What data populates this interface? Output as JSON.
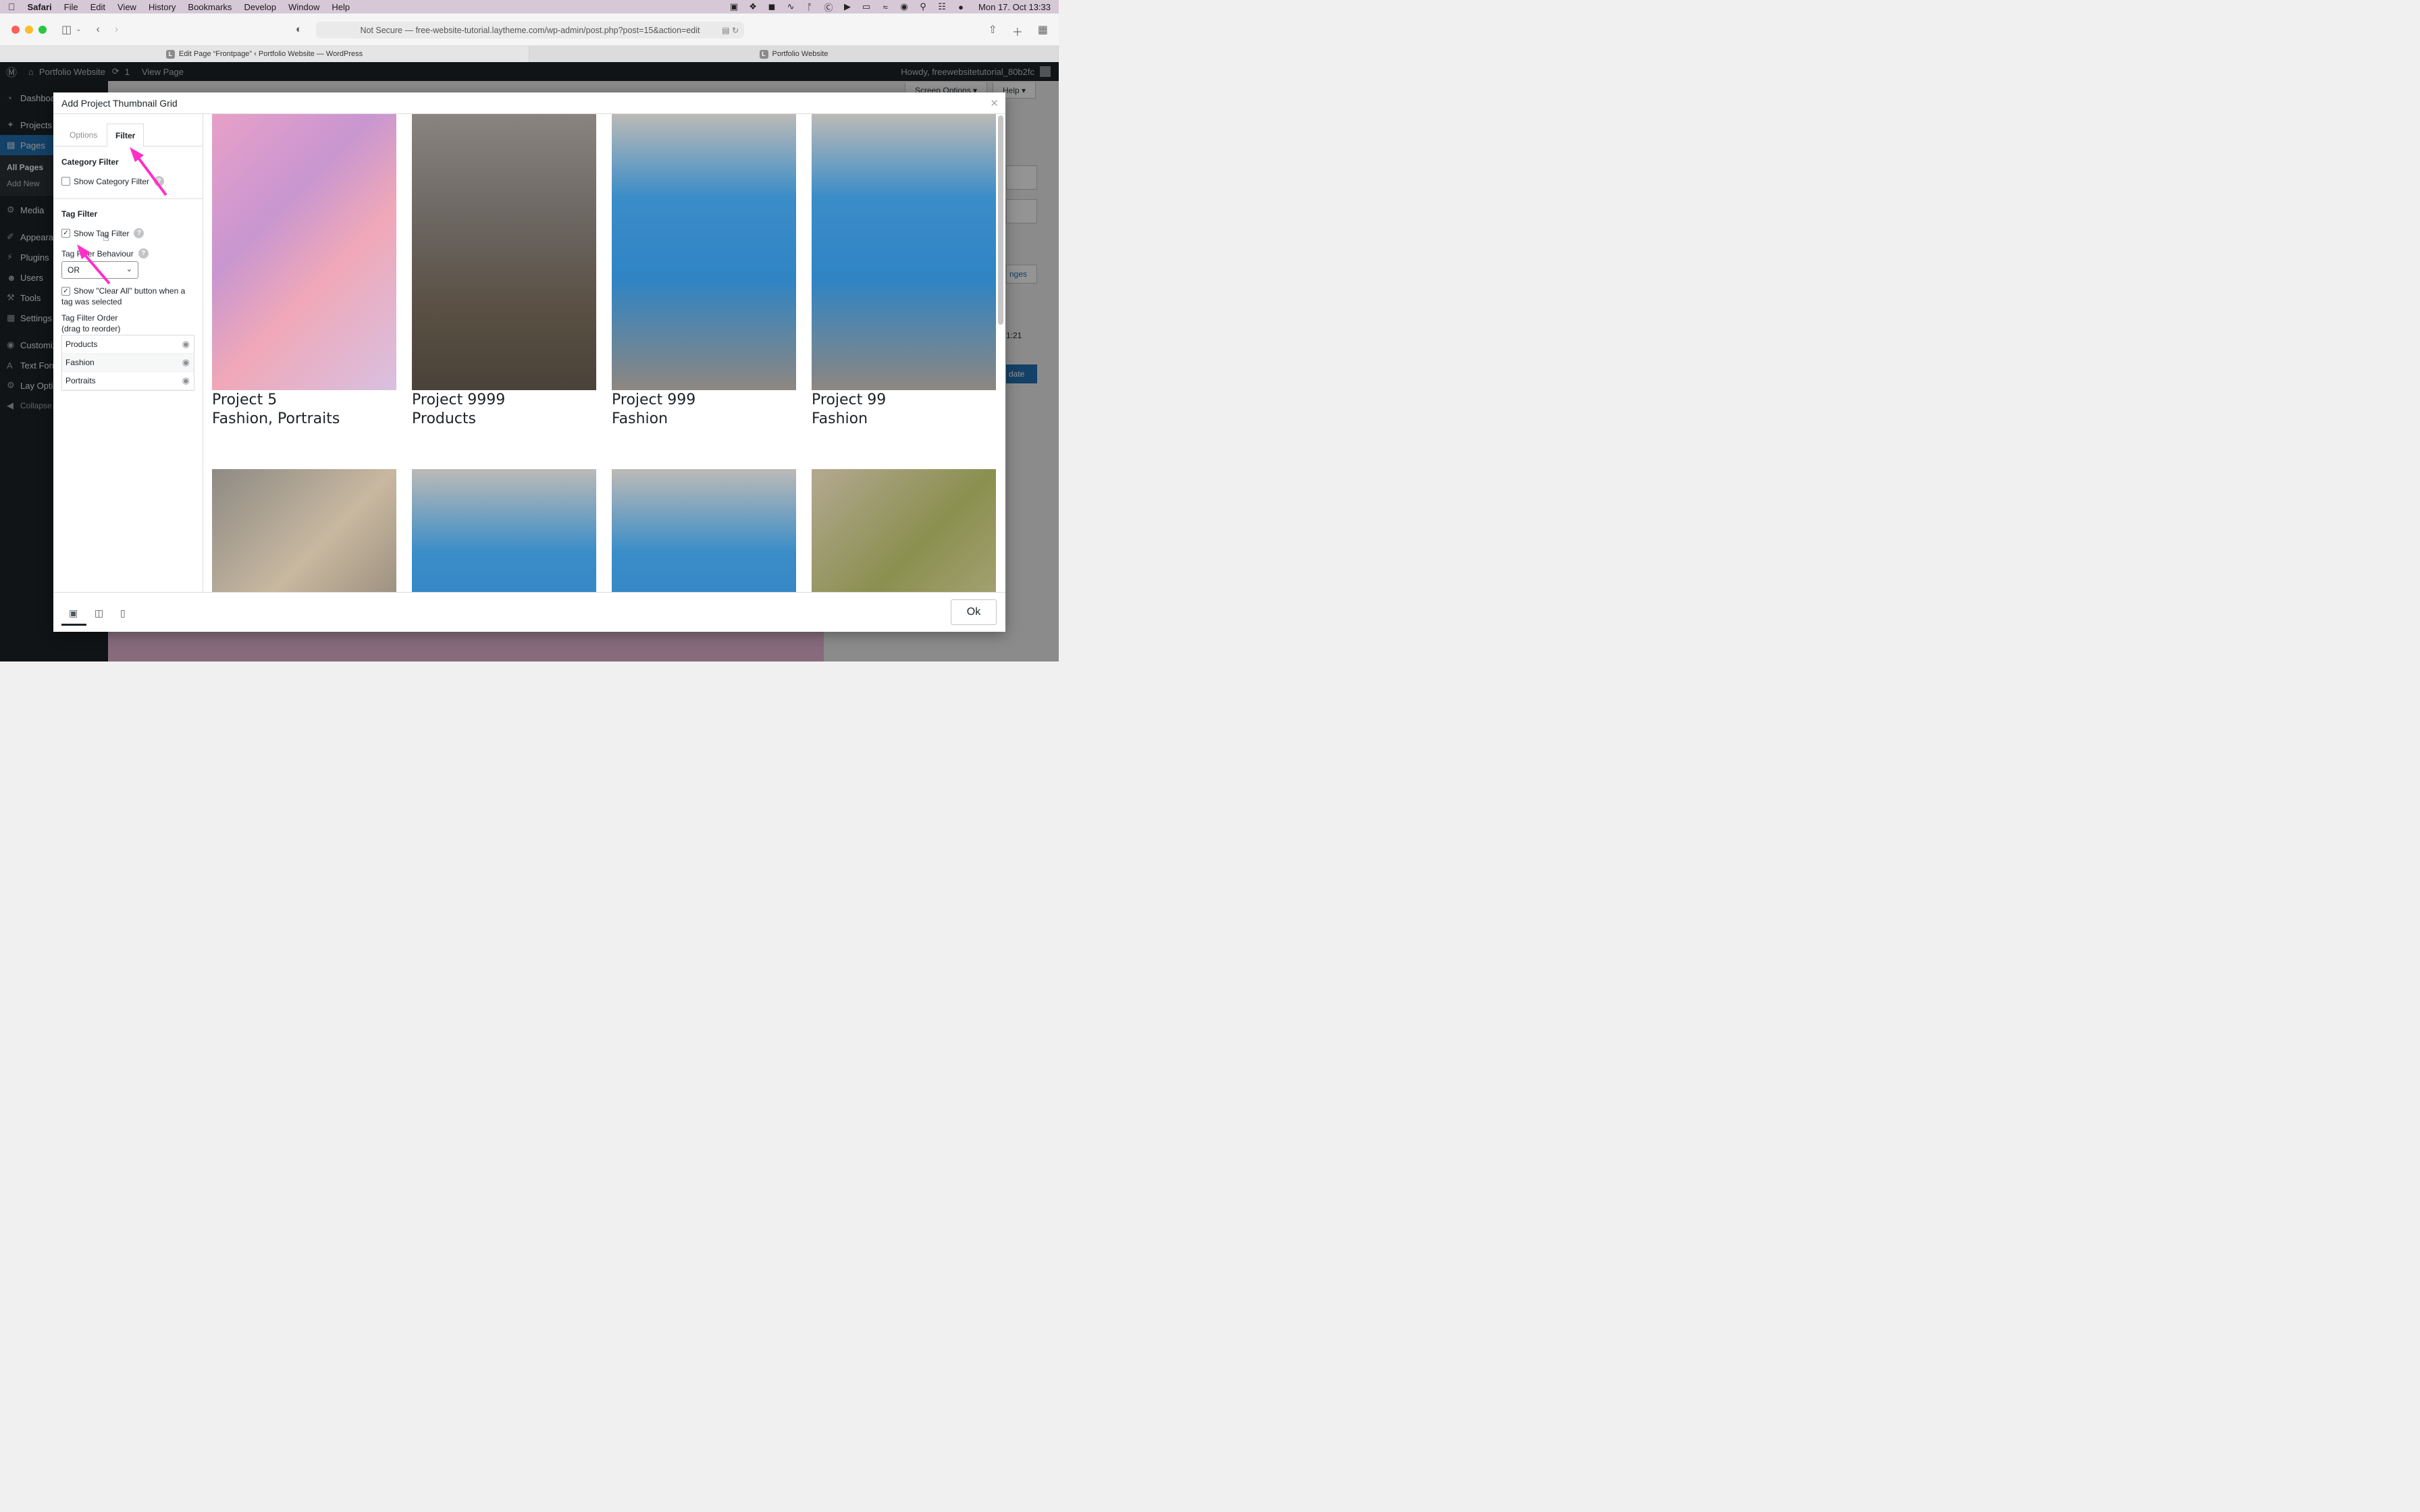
{
  "menubar": {
    "app": "Safari",
    "items": [
      "File",
      "Edit",
      "View",
      "History",
      "Bookmarks",
      "Develop",
      "Window",
      "Help"
    ],
    "clock": "Mon 17. Oct  13:33",
    "status_icons": [
      "screen-record-icon",
      "dropbox-icon",
      "app-icon",
      "scribble-icon",
      "bluetooth-icon",
      "input-a-icon",
      "play-icon",
      "battery-icon",
      "wifi-icon",
      "user-icon",
      "search-icon",
      "control-center-icon",
      "siri-icon"
    ]
  },
  "browser": {
    "address": "Not Secure — free-website-tutorial.laytheme.com/wp-admin/post.php?post=15&action=edit",
    "tabs": [
      {
        "label": "Edit Page “Frontpage” ‹ Portfolio Website — WordPress",
        "favicon": "L"
      },
      {
        "label": "Portfolio Website",
        "favicon": "L"
      }
    ]
  },
  "adminbar": {
    "site": "Portfolio Website",
    "updates": "1",
    "view_page": "View Page",
    "howdy": "Howdy, freewebsitetutorial_80b2fc"
  },
  "wp_sidebar": {
    "items": [
      {
        "label": "Dashboard",
        "icon": "dashboard-icon"
      },
      {
        "label": "Projects",
        "icon": "pin-icon"
      },
      {
        "label": "Pages",
        "icon": "pages-icon"
      }
    ],
    "pages_sub": [
      "All Pages",
      "Add New"
    ],
    "items_more": [
      {
        "label": "Media",
        "icon": "media-icon"
      },
      {
        "label": "Appearance",
        "icon": "brush-icon"
      },
      {
        "label": "Plugins",
        "icon": "plugin-icon"
      },
      {
        "label": "Users",
        "icon": "users-icon"
      },
      {
        "label": "Tools",
        "icon": "tools-icon"
      },
      {
        "label": "Settings",
        "icon": "settings-icon"
      },
      {
        "label": "Customize",
        "icon": "eye-icon"
      },
      {
        "label": "Text Formats",
        "icon": "text-icon"
      },
      {
        "label": "Lay Options",
        "icon": "gear-icon"
      },
      {
        "label": "Collapse menu",
        "icon": "collapse-icon"
      }
    ]
  },
  "wp_content": {
    "screen_options": "Screen Options ▾",
    "help": "Help ▾",
    "changes": "nges",
    "time": "1:21",
    "update": "date"
  },
  "modal": {
    "title": "Add Project Thumbnail Grid",
    "tabs": {
      "options": "Options",
      "filter": "Filter"
    },
    "category_filter": {
      "title": "Category Filter",
      "show_label": "Show Category Filter",
      "checked": false
    },
    "tag_filter": {
      "title": "Tag Filter",
      "show_label": "Show Tag Filter",
      "checked": true,
      "behaviour_label": "Tag Filter Behaviour",
      "behaviour_value": "OR",
      "clear_all_line1": "Show \"Clear All\" button when a",
      "clear_all_line2": "tag was selected",
      "clear_all_checked": true,
      "order_label_line1": "Tag Filter Order",
      "order_label_line2": "(drag to reorder)",
      "order_items": [
        "Products",
        "Fashion",
        "Portraits"
      ]
    },
    "grid": [
      {
        "title": "Project 5",
        "tags": "Fashion, Portraits"
      },
      {
        "title": "Project 9999",
        "tags": "Products"
      },
      {
        "title": "Project 999",
        "tags": "Fashion"
      },
      {
        "title": "Project 99",
        "tags": "Fashion"
      }
    ],
    "ok": "Ok"
  },
  "colors": {
    "annotation_arrow": "#ff2fc8",
    "wp_admin_dark": "#1d2327",
    "wp_blue": "#2271b1"
  }
}
